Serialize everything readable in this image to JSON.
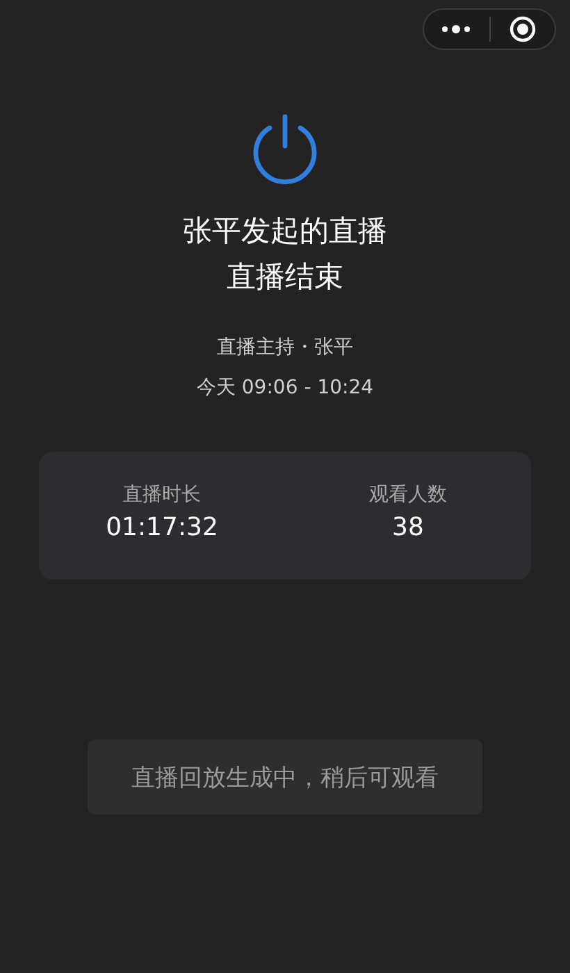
{
  "title_lines": [
    "张平发起的直播",
    "直播结束"
  ],
  "host_line": "直播主持・张平",
  "time_line": "今天 09:06 - 10:24",
  "stats": [
    {
      "label": "直播时长",
      "value": "01:17:32"
    },
    {
      "label": "观看人数",
      "value": "38"
    }
  ],
  "replay_notice": "直播回放生成中，稍后可观看"
}
